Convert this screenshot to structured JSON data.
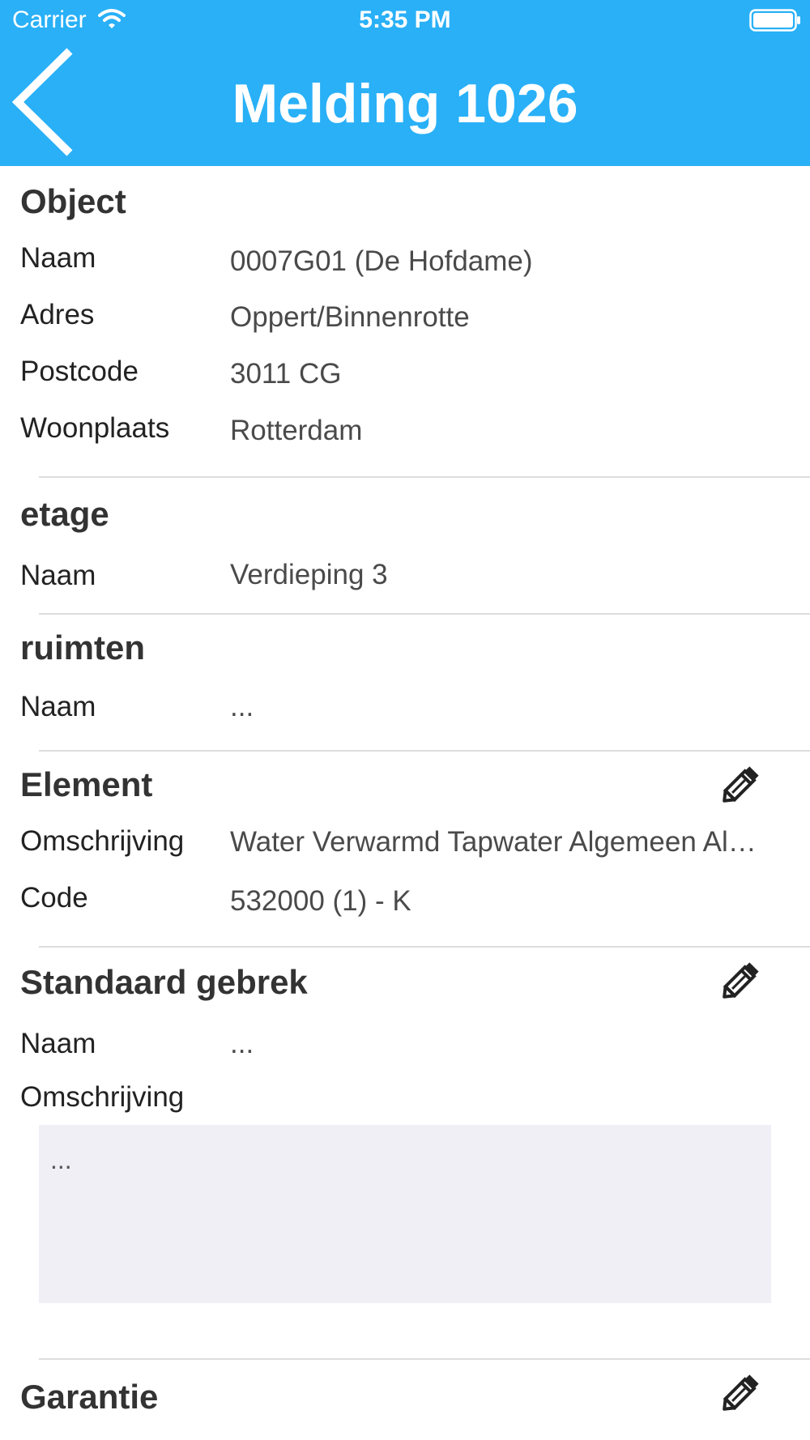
{
  "status_bar": {
    "carrier": "Carrier",
    "time": "5:35 PM"
  },
  "nav": {
    "title": "Melding 1026",
    "back_icon": "chevron-left-icon"
  },
  "object": {
    "title": "Object",
    "rows": [
      {
        "label": "Naam",
        "value": "0007G01 (De Hofdame)"
      },
      {
        "label": "Adres",
        "value": "Oppert/Binnenrotte"
      },
      {
        "label": "Postcode",
        "value": "3011 CG"
      },
      {
        "label": "Woonplaats",
        "value": "Rotterdam"
      }
    ]
  },
  "etage": {
    "title": "etage",
    "rows": [
      {
        "label": "Naam",
        "value": "Verdieping 3"
      }
    ]
  },
  "ruimten": {
    "title": "ruimten",
    "rows": [
      {
        "label": "Naam",
        "value": "..."
      }
    ]
  },
  "element": {
    "title": "Element",
    "edit_icon": "pencil-icon",
    "rows": [
      {
        "label": "Omschrijving",
        "value": "Water Verwarmd Tapwater Algemeen Al…"
      },
      {
        "label": "Code",
        "value": "532000 (1) - K"
      }
    ]
  },
  "standaard_gebrek": {
    "title": "Standaard gebrek",
    "edit_icon": "pencil-icon",
    "rows": [
      {
        "label": "Naam",
        "value": "..."
      }
    ],
    "description_label": "Omschrijving",
    "description_value": "..."
  },
  "garantie": {
    "title": "Garantie",
    "edit_icon": "pencil-icon"
  },
  "colors": {
    "header_bg": "#29b0f7",
    "textbox_bg": "#efeff5",
    "divider": "#dddddd"
  }
}
